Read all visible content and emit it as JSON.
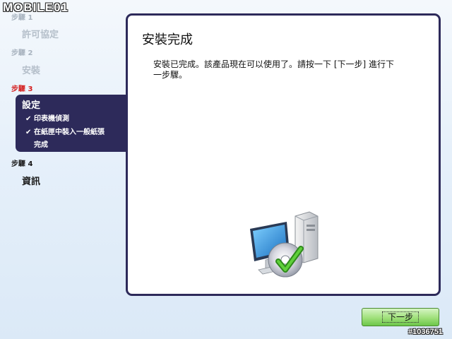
{
  "watermark": "MOBILE01",
  "image_id": "#1036751",
  "sidebar": {
    "steps": [
      {
        "label": "步驟 1",
        "title": "許可協定",
        "state": "done"
      },
      {
        "label": "步驟 2",
        "title": "安裝",
        "state": "done"
      },
      {
        "label": "步驟 3",
        "title": "設定",
        "state": "current",
        "sub_items": [
          {
            "text": "印表機偵測",
            "checked": true
          },
          {
            "text": "在紙匣中裝入一般紙張",
            "checked": true
          },
          {
            "text": "完成",
            "checked": false
          }
        ]
      },
      {
        "label": "步驟 4",
        "title": "資訊",
        "state": "upcoming"
      }
    ]
  },
  "main": {
    "title": "安裝完成",
    "body_line1": "安裝已完成。該產品現在可以使用了。請按一下 [下一步] 進行下",
    "body_line2": "一步驟。"
  },
  "buttons": {
    "next_label": "下一步"
  },
  "colors": {
    "panel_border": "#2d2a5a",
    "current_step_label": "#d42020",
    "next_button": "#9fe07a"
  }
}
